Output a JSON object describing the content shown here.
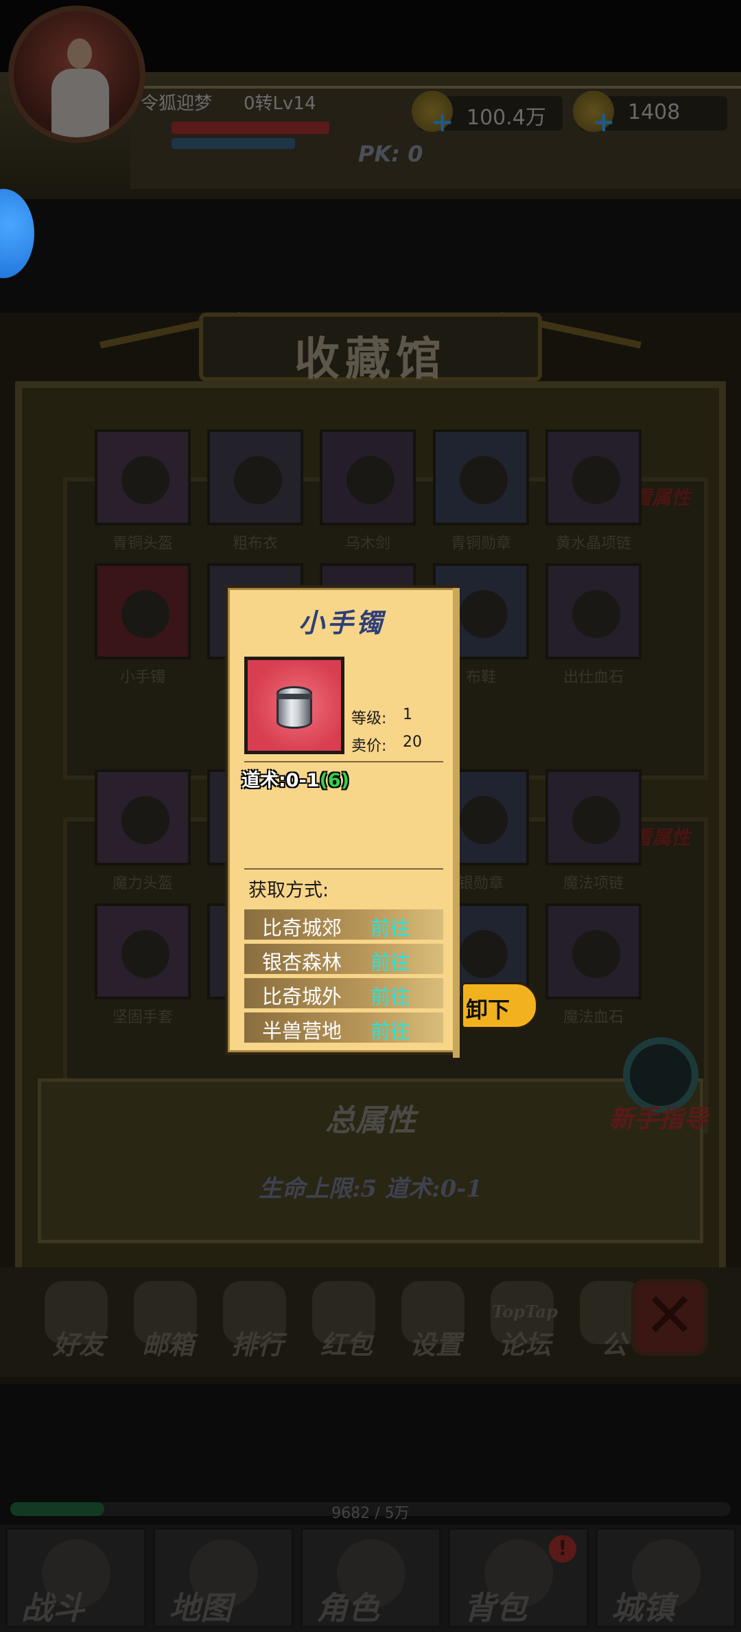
{
  "player": {
    "name": "令狐迎梦",
    "level": "0转Lv14",
    "pk": "PK: 0"
  },
  "resources": {
    "gold": "100.4万",
    "ingot": "1408"
  },
  "museum": {
    "title": "收藏馆",
    "shelf1_banner": "点击查看属性",
    "shelf2_banner": "点击查看属性",
    "shelf1_items": [
      "青铜头盔",
      "粗布衣",
      "乌木剑",
      "青铜勋章",
      "黄水晶项链",
      "小手镯",
      "",
      "",
      "布鞋",
      "出仕血石"
    ],
    "shelf2_items": [
      "魔力头盔",
      "",
      "",
      "银勋章",
      "魔法项链",
      "坚固手套",
      "",
      "",
      "",
      "魔法血石"
    ],
    "total_title": "总属性",
    "total_values": "生命上限:5   道术:0-1",
    "guide": "新手指导"
  },
  "toolbar": [
    "好友",
    "邮箱",
    "排行",
    "红包",
    "设置",
    "论坛",
    "公"
  ],
  "toolbar_forum_top": "TopTap",
  "xp": {
    "text": "9682 / 5万",
    "fill": 0.13
  },
  "bottom_nav": [
    "战斗",
    "地图",
    "角色",
    "背包",
    "城镇"
  ],
  "tooltip": {
    "title": "小手镯",
    "level_label": "等级:",
    "level_value": "1",
    "price_label": "卖价:",
    "price_value": "20",
    "attr_main": "道术:0-1",
    "attr_bonus_open": "(",
    "attr_bonus": "6",
    "attr_bonus_close": ")",
    "source_label": "获取方式:",
    "sources": [
      {
        "name": "比奇城郊",
        "action": "前往"
      },
      {
        "name": "银杏森林",
        "action": "前往"
      },
      {
        "name": "比奇城外",
        "action": "前往"
      },
      {
        "name": "半兽营地",
        "action": "前往"
      }
    ]
  },
  "unequip_label": "卸下",
  "colors": {
    "tooltip_bg": "#f7d589",
    "go_link": "#1fe6e0",
    "unequip_bg": "#f2b21f",
    "attr_bonus": "#33d14e"
  }
}
